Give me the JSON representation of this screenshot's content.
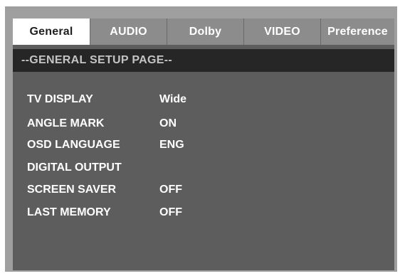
{
  "tabs": [
    {
      "label": "General",
      "active": true
    },
    {
      "label": "AUDIO",
      "active": false
    },
    {
      "label": "Dolby",
      "active": false
    },
    {
      "label": "VIDEO",
      "active": false
    },
    {
      "label": "Preference",
      "active": false
    }
  ],
  "page_title": "--GENERAL SETUP PAGE--",
  "settings": [
    {
      "label": "TV DISPLAY",
      "value": "Wide"
    },
    {
      "label": "ANGLE MARK",
      "value": "ON"
    },
    {
      "label": "OSD LANGUAGE",
      "value": "ENG"
    },
    {
      "label": "DIGITAL OUTPUT",
      "value": ""
    },
    {
      "label": "SCREEN SAVER",
      "value": "OFF"
    },
    {
      "label": "LAST MEMORY",
      "value": "OFF"
    }
  ],
  "colors": {
    "screen_background": "#5d5d5d",
    "tab_inactive": "#8c8c8c",
    "tab_active": "#ffffff",
    "header_background": "#262626",
    "header_text": "#c4c4c4",
    "text": "#ffffff"
  }
}
